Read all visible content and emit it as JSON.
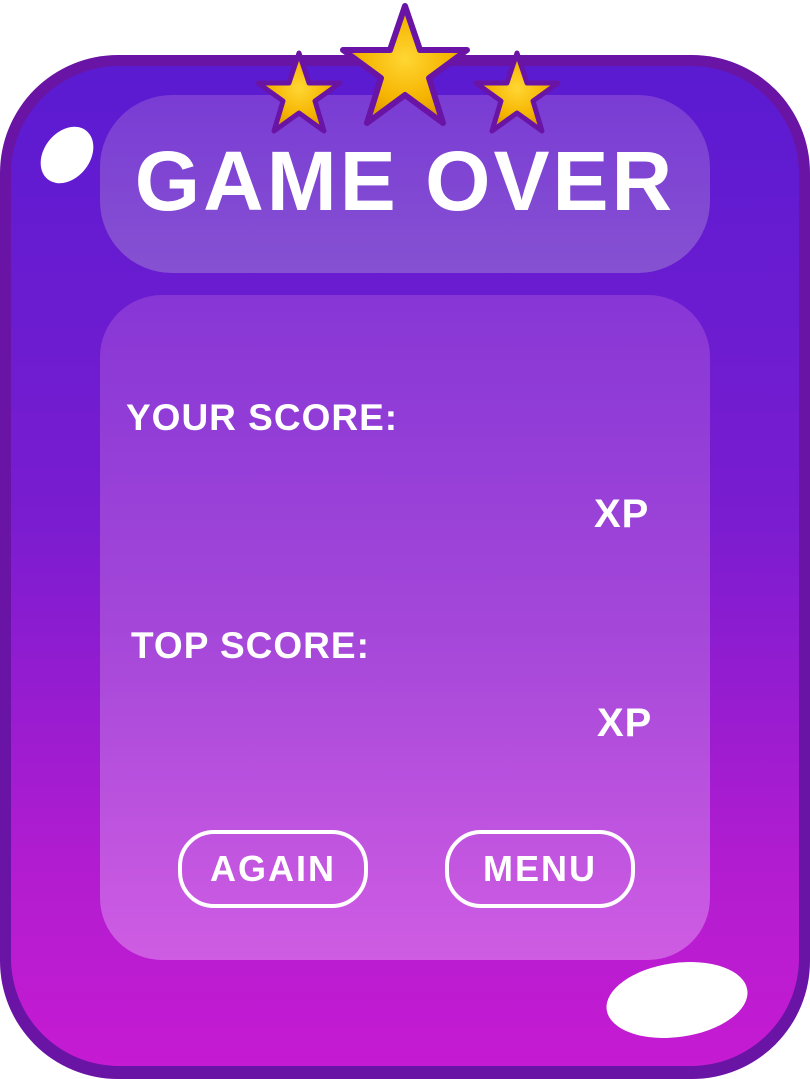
{
  "title": "GAME OVER",
  "score_panel": {
    "your_score_label": "YOUR SCORE:",
    "your_score_unit": "XP",
    "top_score_label": "TOP SCORE:",
    "top_score_unit": "XP"
  },
  "buttons": {
    "again_label": "AGAIN",
    "menu_label": "MENU"
  },
  "rating": {
    "stars_earned": 3,
    "stars_total": 3
  },
  "colors": {
    "panel_border": "#6a14a6",
    "panel_top": "#5a1bd1",
    "panel_bottom": "#c51bd2",
    "star_fill": "#f5b400",
    "star_outline": "#6a14a6",
    "text": "#ffffff"
  }
}
